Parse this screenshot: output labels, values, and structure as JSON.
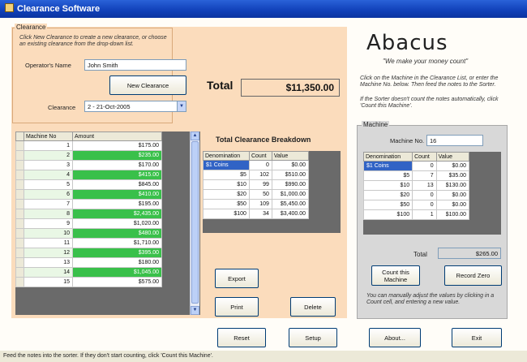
{
  "window": {
    "title": "Clearance Software"
  },
  "clearance_panel": {
    "legend": "Clearance",
    "instructions": "Click New Clearance to create a new clearance, or choose an existing clearance from the drop-down list.",
    "operator_label": "Operator's Name",
    "operator_value": "John Smith",
    "new_clearance_label": "New Clearance",
    "clearance_label": "Clearance",
    "clearance_selected": "2 - 21-Oct-2005"
  },
  "total": {
    "label": "Total",
    "value": "$11,350.00"
  },
  "machines_grid": {
    "columns": [
      "Machine No",
      "Amount"
    ],
    "rows": [
      {
        "machine": "1",
        "amount": "$175.00",
        "highlight": false
      },
      {
        "machine": "2",
        "amount": "$235.00",
        "highlight": true
      },
      {
        "machine": "3",
        "amount": "$170.00",
        "highlight": false
      },
      {
        "machine": "4",
        "amount": "$415.00",
        "highlight": true
      },
      {
        "machine": "5",
        "amount": "$845.00",
        "highlight": false
      },
      {
        "machine": "6",
        "amount": "$410.00",
        "highlight": true
      },
      {
        "machine": "7",
        "amount": "$195.00",
        "highlight": false
      },
      {
        "machine": "8",
        "amount": "$2,435.00",
        "highlight": true
      },
      {
        "machine": "9",
        "amount": "$1,020.00",
        "highlight": false
      },
      {
        "machine": "10",
        "amount": "$480.00",
        "highlight": true
      },
      {
        "machine": "11",
        "amount": "$1,710.00",
        "highlight": false
      },
      {
        "machine": "12",
        "amount": "$395.00",
        "highlight": true
      },
      {
        "machine": "13",
        "amount": "$180.00",
        "highlight": false
      },
      {
        "machine": "14",
        "amount": "$1,045.00",
        "highlight": true
      },
      {
        "machine": "15",
        "amount": "$575.00",
        "highlight": false
      }
    ]
  },
  "breakdown": {
    "title": "Total Clearance Breakdown",
    "columns": [
      "Denomination",
      "Count",
      "Value"
    ],
    "rows": [
      {
        "denom": "$1 Coins",
        "count": "0",
        "value": "$0.00"
      },
      {
        "denom": "$5",
        "count": "102",
        "value": "$510.00"
      },
      {
        "denom": "$10",
        "count": "99",
        "value": "$990.00"
      },
      {
        "denom": "$20",
        "count": "50",
        "value": "$1,000.00"
      },
      {
        "denom": "$50",
        "count": "109",
        "value": "$5,450.00"
      },
      {
        "denom": "$100",
        "count": "34",
        "value": "$3,400.00"
      }
    ]
  },
  "actions": {
    "export": "Export",
    "print": "Print",
    "delete": "Delete"
  },
  "brand": {
    "name": "Abacus",
    "slogan": "\"We make your money count\""
  },
  "machine_instructions": [
    "Click on the Machine in the Clearance List, or enter the Machine No. below. Then feed the notes to the Sorter.",
    "If the Sorter doesn't count the notes automatically, click 'Count this Machine'."
  ],
  "machine_panel": {
    "legend": "Machine",
    "machine_no_label": "Machine No.",
    "machine_no_value": "16",
    "columns": [
      "Denomination",
      "Count",
      "Value"
    ],
    "rows": [
      {
        "denom": "$1 Coins",
        "count": "0",
        "value": "$0.00"
      },
      {
        "denom": "$5",
        "count": "7",
        "value": "$35.00"
      },
      {
        "denom": "$10",
        "count": "13",
        "value": "$130.00"
      },
      {
        "denom": "$20",
        "count": "0",
        "value": "$0.00"
      },
      {
        "denom": "$50",
        "count": "0",
        "value": "$0.00"
      },
      {
        "denom": "$100",
        "count": "1",
        "value": "$100.00"
      }
    ],
    "total_label": "Total",
    "total_value": "$265.00",
    "count_label": "Count this Machine",
    "record_zero_label": "Record Zero",
    "note": "You can manually adjust the values by clicking in a Count cell, and entering a new value."
  },
  "bottom_buttons": {
    "reset": "Reset",
    "setup": "Setup",
    "about": "About...",
    "exit": "Exit"
  },
  "status": "Feed the notes into the sorter. If they don't start counting, click 'Count this Machine'.",
  "colors": {
    "panel": "#fbdcbc",
    "machine_panel": "#d8d8d8",
    "green_cell": "#39c04a",
    "selection": "#3163c5",
    "titlebar": "#1040b8"
  }
}
